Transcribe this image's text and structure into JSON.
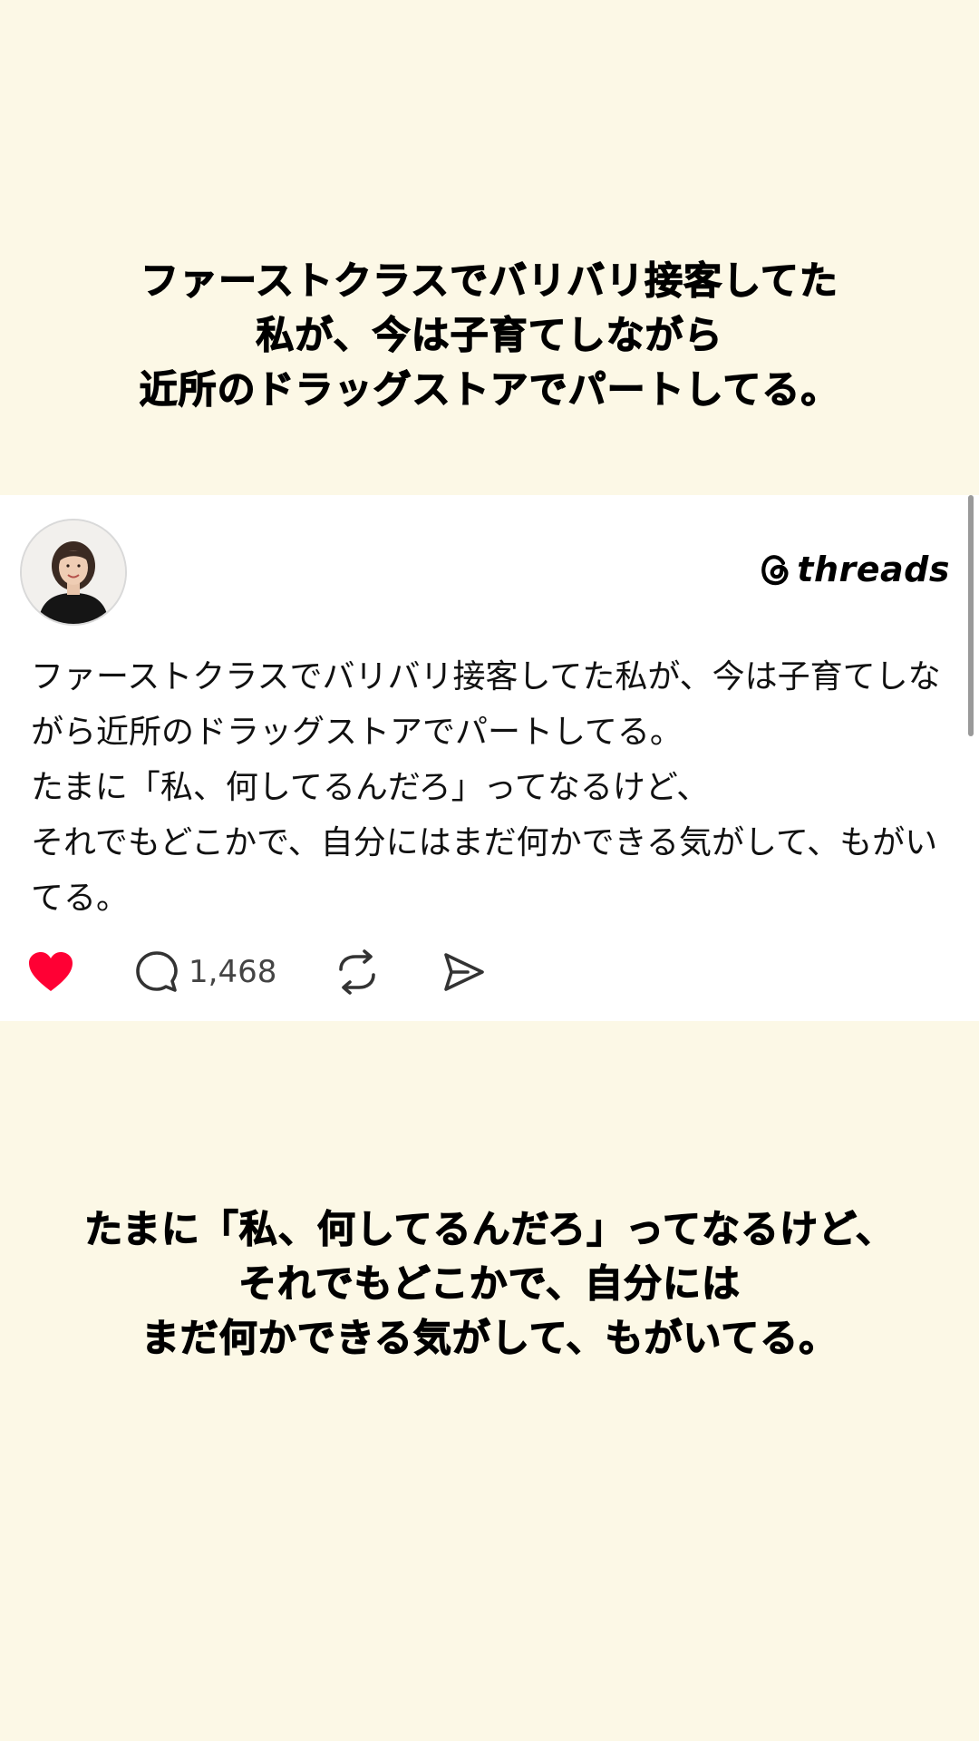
{
  "top_caption": {
    "line1": "ファーストクラスでバリバリ接客してた",
    "line2": "私が、今は子育てしながら",
    "line3": "近所のドラッグストアでパートしてる。"
  },
  "post": {
    "brand": "threads",
    "brand_icon": "threads-at-icon",
    "avatar_icon": "profile-photo",
    "paragraphs": {
      "p1": "ファーストクラスでバリバリ接客してた私が、今は子育てしながら近所のドラッグストアでパートしてる。",
      "p2": "たまに「私、何してるんだろ」ってなるけど、",
      "p3": "それでもどこかで、自分にはまだ何かできる気がして、もがいてる。"
    },
    "actions": {
      "like_icon": "heart-filled-icon",
      "reply_icon": "comment-bubble-icon",
      "reply_count": "1,468",
      "repost_icon": "repost-icon",
      "share_icon": "send-icon"
    },
    "like_color": "#ff0034"
  },
  "bottom_caption": {
    "line1": "たまに「私、何してるんだろ」ってなるけど、",
    "line2": "それでもどこかで、自分には",
    "line3": "まだ何かできる気がして、もがいてる。"
  },
  "colors": {
    "background": "#fcf8e6",
    "card": "#ffffff"
  }
}
